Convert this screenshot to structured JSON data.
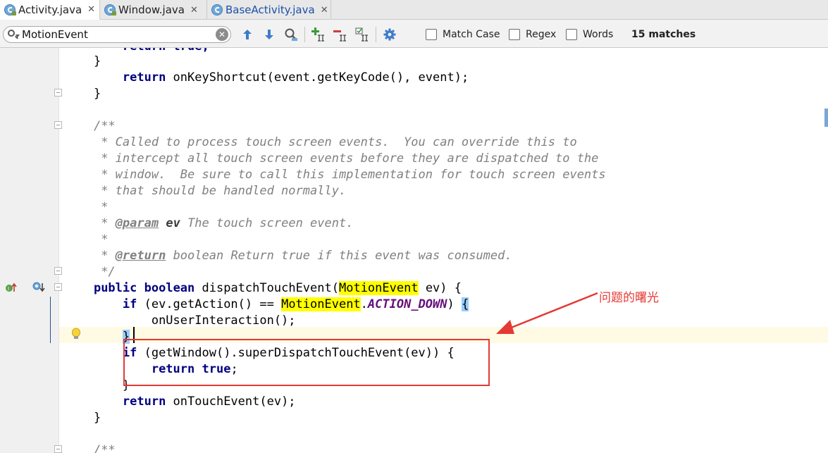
{
  "tabs": [
    {
      "label": "Activity.java",
      "active": true,
      "color": "#222222"
    },
    {
      "label": "Window.java",
      "active": false,
      "color": "#222222"
    },
    {
      "label": "BaseActivity.java",
      "active": false,
      "color": "#1b4fa8"
    }
  ],
  "tab_close_glyph": "✕",
  "find": {
    "query": "MotionEvent",
    "clear_glyph": "✕",
    "options": {
      "match_case": "Match Case",
      "regex": "Regex",
      "words": "Words"
    },
    "matches": "15 matches"
  },
  "toolbar_icons": [
    "arrow-up-icon",
    "arrow-down-icon",
    "find-all-icon",
    "add-occurrence-icon",
    "remove-occurrence-icon",
    "select-all-occurrences-icon",
    "settings-icon"
  ],
  "code": {
    "l0": "        return true;",
    "l1": "    }",
    "l2_kw": "return",
    "l2_rest": " onKeyShortcut(event.getKeyCode(), event);",
    "l3": "}",
    "c_open": "/**",
    "c1": " * Called to process touch screen events.  You can override this to",
    "c2": " * intercept all touch screen events before they are dispatched to the",
    "c3": " * window.  Be sure to call this implementation for touch screen events",
    "c4": " * that should be handled normally.",
    "c_star": " *",
    "c_param_pre": " * ",
    "c_param_tag": "@param",
    "c_param_name": "ev",
    "c_param_rest": " The touch screen event.",
    "c_return_tag": "@return",
    "c_return_rest": " boolean Return true if this event was consumed.",
    "c_close": " */",
    "sig_kw1": "public",
    "sig_kw2": "boolean",
    "sig_name": " dispatchTouchEvent(",
    "sig_type": "MotionEvent",
    "sig_rest": " ev) {",
    "if1_kw": "if",
    "if1_mid": " (ev.getAction() == ",
    "if1_type": "MotionEvent",
    "if1_dot": ".",
    "if1_const": "ACTION_DOWN",
    "if1_close": ") ",
    "if1_brace": "{",
    "call1": "onUserInteraction();",
    "brace_hl": "}",
    "if2_kw": "if",
    "if2_rest": " (getWindow().superDispatchTouchEvent(ev)) {",
    "ret_kw": "return",
    "ret_val": "true",
    "ret_semi": ";",
    "close_brace": "}",
    "ret2_kw": "return",
    "ret2_rest": " onTouchEvent(ev);",
    "end_brace": "}",
    "next_doc": "/**"
  },
  "annotation": {
    "text": "问题的曙光",
    "color": "#e53935"
  }
}
